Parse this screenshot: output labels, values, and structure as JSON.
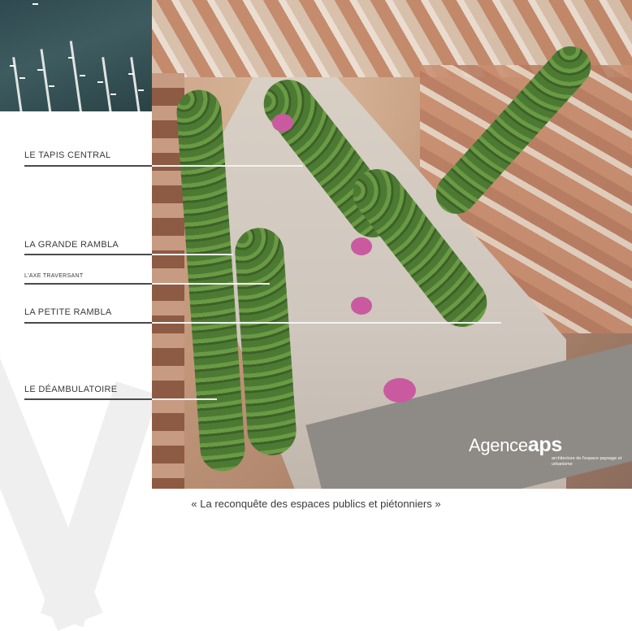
{
  "labels": {
    "tapis_central": "LE TAPIS CENTRAL",
    "grande_rambla": "LA GRANDE RAMBLA",
    "axe_traversant": "L'AXE TRAVERSANT",
    "petite_rambla": "LA PETITE RAMBLA",
    "deambulatoire": "LE DÉAMBULATOIRE"
  },
  "logo": {
    "name_light": "Agence",
    "name_bold": "aps",
    "tagline": "architecture de l'espace paysage et urbanisme"
  },
  "caption": "« La reconquête des espaces publics et piétonniers »",
  "colors": {
    "label_text": "#3a3a3a",
    "leader_line": "#4a4a4a",
    "logo_text": "#ffffff"
  }
}
